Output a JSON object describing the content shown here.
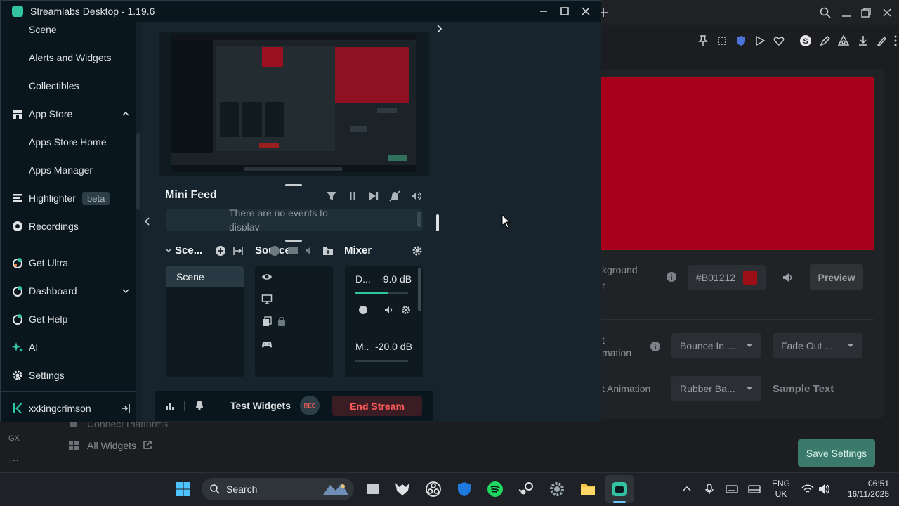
{
  "window": {
    "title": "Streamlabs Desktop - 1.19.6"
  },
  "sidebar": {
    "items": [
      {
        "label": "Scene"
      },
      {
        "label": "Alerts and Widgets"
      },
      {
        "label": "Collectibles"
      },
      {
        "label": "App Store"
      },
      {
        "label": "Apps Store Home"
      },
      {
        "label": "Apps Manager"
      },
      {
        "label": "Highlighter",
        "badge": "beta"
      },
      {
        "label": "Recordings"
      },
      {
        "label": "Get Ultra"
      },
      {
        "label": "Dashboard"
      },
      {
        "label": "Get Help"
      },
      {
        "label": "AI"
      },
      {
        "label": "Settings"
      }
    ],
    "user": "xxkingcrimson"
  },
  "mini_feed": {
    "title": "Mini Feed",
    "empty_message": "There are no events to display"
  },
  "scenes": {
    "title": "Sce...",
    "items": [
      "Scene"
    ]
  },
  "sources": {
    "title": "Sources"
  },
  "mixer": {
    "title": "Mixer",
    "channels": [
      {
        "name": "D...",
        "level": "-9.0 dB",
        "fill": 0.62
      },
      {
        "name": "M..",
        "level": "-20.0 dB",
        "fill": 0.0
      }
    ]
  },
  "footer": {
    "test_widgets": "Test Widgets",
    "rec": "REC",
    "end_stream": "End Stream"
  },
  "background": {
    "label_background": "kground",
    "label_background2": "r",
    "color_value": "#B01212",
    "preview": "Preview",
    "label_animation": "t",
    "label_animation2": "mation",
    "show_anim": "Bounce In ...",
    "hide_anim": "Fade Out ...",
    "text_anim_label": "t Animation",
    "text_anim": "Rubber Ba...",
    "sample_text": "Sample Text",
    "save_settings": "Save Settings",
    "connect_platforms": "Connect Platforms",
    "all_widgets": "All Widgets",
    "gx_label": "GX",
    "accent_red": "#a8001c"
  },
  "taskbar": {
    "search": "Search",
    "lang_top": "ENG",
    "lang_bottom": "UK",
    "time": "06:51",
    "date": "16/11/2025"
  }
}
